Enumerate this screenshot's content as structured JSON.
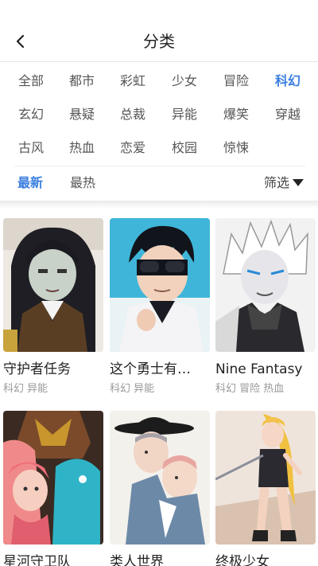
{
  "header": {
    "title": "分类",
    "back_icon": "chevron-left-icon"
  },
  "genres": [
    [
      "全部",
      "都市",
      "彩虹",
      "少女",
      "冒险",
      "科幻"
    ],
    [
      "玄幻",
      "悬疑",
      "总裁",
      "异能",
      "爆笑",
      "穿越"
    ],
    [
      "古风",
      "热血",
      "恋爱",
      "校园",
      "惊悚"
    ]
  ],
  "active_genre": "科幻",
  "sort": {
    "newest": "最新",
    "hottest": "最热",
    "active": "最新",
    "filter_label": "筛选"
  },
  "colors": {
    "accent": "#3b7fe0"
  },
  "comics": [
    {
      "title": "守护者任务",
      "tags": "科幻 异能"
    },
    {
      "title": "这个勇士有…",
      "tags": "科幻 异能"
    },
    {
      "title": "Nine Fantasy",
      "tags": "科幻 冒险 热血"
    },
    {
      "title": "星河守卫队",
      "tags": ""
    },
    {
      "title": "类人世界",
      "tags": ""
    },
    {
      "title": "终极少女",
      "tags": ""
    }
  ]
}
